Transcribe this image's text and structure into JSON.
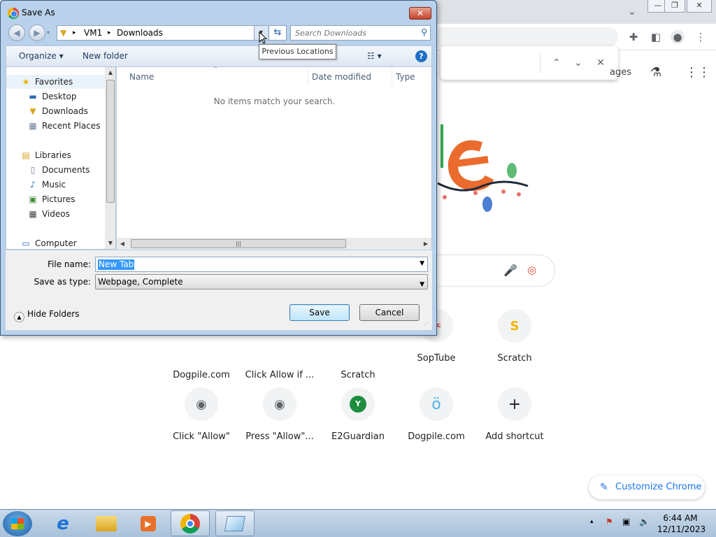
{
  "dialog": {
    "title": "Save As",
    "close_glyph": "✕",
    "back_glyph": "◀",
    "forward_glyph": "▶",
    "breadcrumb": [
      "VM1",
      "Downloads"
    ],
    "crumb_separator": "▸",
    "search_placeholder": "Search Downloads",
    "tooltip": "Previous Locations",
    "commands": {
      "organize": "Organize ▾",
      "new_folder": "New folder",
      "view_glyph": "☷ ▾",
      "help_glyph": "?"
    },
    "nav_tree": [
      {
        "label": "Favorites",
        "icon": "star-icon",
        "glyph": "★",
        "color": "#e8b400"
      },
      {
        "label": "Desktop",
        "icon": "desktop-icon",
        "glyph": "▬",
        "color": "#2f6cb8"
      },
      {
        "label": "Downloads",
        "icon": "downloads-folder-icon",
        "glyph": "▼",
        "color": "#d9a521"
      },
      {
        "label": "Recent Places",
        "icon": "recent-places-icon",
        "glyph": "▦",
        "color": "#6b7f99"
      },
      {
        "label": "Libraries",
        "icon": "libraries-icon",
        "glyph": "▤",
        "color": "#d9a521"
      },
      {
        "label": "Documents",
        "icon": "documents-icon",
        "glyph": "▯",
        "color": "#6b7f99"
      },
      {
        "label": "Music",
        "icon": "music-icon",
        "glyph": "♪",
        "color": "#2f6cb8"
      },
      {
        "label": "Pictures",
        "icon": "pictures-icon",
        "glyph": "▣",
        "color": "#3b8a3b"
      },
      {
        "label": "Videos",
        "icon": "videos-icon",
        "glyph": "▦",
        "color": "#444444"
      },
      {
        "label": "Computer",
        "icon": "computer-icon",
        "glyph": "▭",
        "color": "#2f6cb8"
      }
    ],
    "columns": [
      "Name",
      "Date modified",
      "Type"
    ],
    "empty_message": "No items match your search.",
    "file_name_label": "File name:",
    "file_name_value": "New Tab",
    "save_as_type_label": "Save as type:",
    "save_as_type_value": "Webpage, Complete",
    "hide_folders": "Hide Folders",
    "save_button": "Save",
    "cancel_button": "Cancel"
  },
  "chrome": {
    "ntp_link_fragment": "ages",
    "shortcuts_row1": [
      {
        "label": "Dogpile.com",
        "glyph": ""
      },
      {
        "label": "Click Allow if ...",
        "glyph": ""
      },
      {
        "label": "Scratch",
        "glyph": ""
      },
      {
        "label": "SopTube",
        "glyph": "✂",
        "color": "#d93025"
      },
      {
        "label": "Scratch",
        "glyph": "S",
        "color": "#f4b400"
      }
    ],
    "shortcuts_row2": [
      {
        "label": "Click \"Allow\"",
        "glyph": "◉",
        "color": "#5f6368"
      },
      {
        "label": "Press \"Allow\"...",
        "glyph": "◉",
        "color": "#5f6368"
      },
      {
        "label": "E2Guardian",
        "glyph": "Y",
        "color": "#1e8e3e"
      },
      {
        "label": "Dogpile.com",
        "glyph": "ö",
        "color": "#4fb3e8"
      },
      {
        "label": "Add shortcut",
        "glyph": "+",
        "color": "#202124"
      }
    ],
    "customize": "Customize Chrome",
    "find_prev": "⌃",
    "find_next": "⌄",
    "find_close": "✕"
  },
  "taskbar": {
    "time": "6:44 AM",
    "date": "12/11/2023",
    "tray_glyphs": [
      "▴",
      "⚑",
      "▣",
      "🔈"
    ]
  }
}
